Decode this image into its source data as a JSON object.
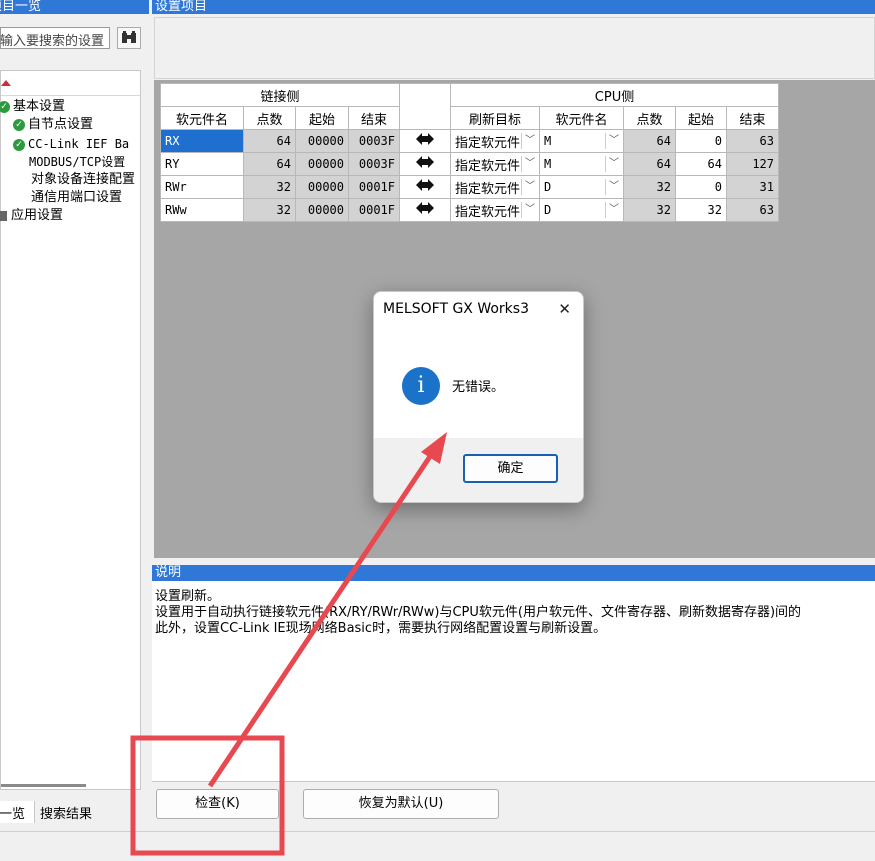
{
  "left_panel": {
    "title": "项目一览",
    "search_placeholder": "输入要搜索的设置",
    "tree": {
      "basic": "基本设置",
      "self_node": "自节点设置",
      "cclink": "CC-Link IEF Ba",
      "modbus": "MODBUS/TCP设置",
      "target_device": "对象设备连接配置",
      "comm_port": "通信用端口设置",
      "application": "应用设置"
    },
    "tabs": {
      "list": "一览",
      "search_results": "搜索结果"
    }
  },
  "settings": {
    "title": "设置项目",
    "table": {
      "group_link": "链接侧",
      "group_cpu": "CPU侧",
      "headers": {
        "device_name": "软元件名",
        "points": "点数",
        "start": "起始",
        "end": "结束",
        "refresh_target": "刷新目标",
        "cpu_device_name": "软元件名",
        "cpu_points": "点数",
        "cpu_start": "起始",
        "cpu_end": "结束"
      },
      "rows": [
        {
          "name": "RX",
          "points": "64",
          "start": "00000",
          "end": "0003F",
          "target": "指定软元件",
          "device": "M",
          "cpu_points": "64",
          "cpu_start": "0",
          "cpu_end": "63"
        },
        {
          "name": "RY",
          "points": "64",
          "start": "00000",
          "end": "0003F",
          "target": "指定软元件",
          "device": "M",
          "cpu_points": "64",
          "cpu_start": "64",
          "cpu_end": "127"
        },
        {
          "name": "RWr",
          "points": "32",
          "start": "00000",
          "end": "0001F",
          "target": "指定软元件",
          "device": "D",
          "cpu_points": "32",
          "cpu_start": "0",
          "cpu_end": "31"
        },
        {
          "name": "RWw",
          "points": "32",
          "start": "00000",
          "end": "0001F",
          "target": "指定软元件",
          "device": "D",
          "cpu_points": "32",
          "cpu_start": "32",
          "cpu_end": "63"
        }
      ]
    }
  },
  "description": {
    "title": "说明",
    "line1": "设置刷新。",
    "line2": "设置用于自动执行链接软元件(RX/RY/RWr/RWw)与CPU软元件(用户软元件、文件寄存器、刷新数据寄存器)间的",
    "line3": "此外，设置CC-Link IE现场网络Basic时，需要执行网络配置设置与刷新设置。"
  },
  "buttons": {
    "check": "检查(K)",
    "restore_default": "恢复为默认(U)"
  },
  "dialog": {
    "title": "MELSOFT GX Works3",
    "message": "无错误。",
    "ok": "确定",
    "close_glyph": "✕",
    "info_glyph": "i"
  },
  "annotation": {
    "highlight_color": "#e8484f"
  }
}
